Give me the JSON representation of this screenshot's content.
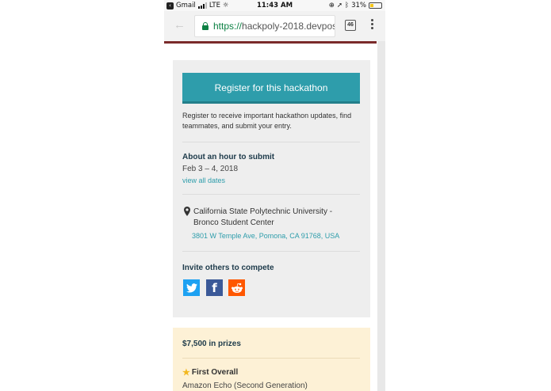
{
  "status_bar": {
    "back_app": "Gmail",
    "network": "LTE",
    "time": "11:43 AM",
    "battery": "31%",
    "battery_level": 0.31
  },
  "browser": {
    "url_scheme": "https://",
    "url_host": "hackpoly-2018.devpos…",
    "tab_count": "46"
  },
  "sidebar_card": {
    "register_button": "Register for this hackathon",
    "register_description": "Register to receive important hackathon updates, find teammates, and submit your entry.",
    "submit_title": "About an hour to submit",
    "submit_dates": "Feb 3 – 4, 2018",
    "view_all_dates": "view all dates",
    "venue_name": "California State Polytechnic University - Bronco Student Center",
    "venue_address": "3801 W Temple Ave, Pomona, CA 91768, USA",
    "invite_title": "Invite others to compete",
    "share_icons": [
      "twitter-icon",
      "facebook-icon",
      "reddit-icon"
    ]
  },
  "prizes": {
    "total": "$7,500 in prizes",
    "first_title": "First Overall",
    "first_item": "Amazon Echo (Second Generation)"
  },
  "colors": {
    "accent": "#2e9dab",
    "heading": "#1d3a4a",
    "card_bg": "#eeeeee",
    "prize_bg": "#fdf1d6",
    "brand_bar": "#7a2a2a"
  }
}
